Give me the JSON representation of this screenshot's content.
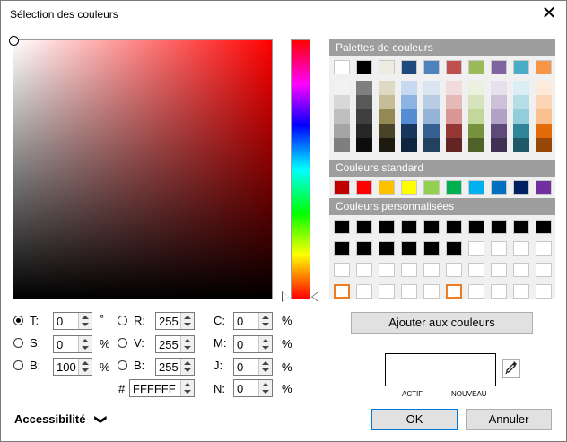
{
  "window": {
    "title": "Sélection des couleurs",
    "close_glyph": "✕"
  },
  "palettes": {
    "header": "Palettes de couleurs",
    "top_row": [
      "#ffffff",
      "#000000",
      "#eeece1",
      "#1f497d",
      "#4f81bd",
      "#c0504d",
      "#9bbb59",
      "#8064a2",
      "#4bacc6",
      "#f79646"
    ],
    "tint_columns": [
      [
        "#f2f2f2",
        "#d8d8d8",
        "#bfbfbf",
        "#a5a5a5",
        "#7f7f7f"
      ],
      [
        "#7f7f7f",
        "#595959",
        "#3f3f3f",
        "#262626",
        "#0c0c0c"
      ],
      [
        "#ddd9c3",
        "#c4bd97",
        "#938953",
        "#494429",
        "#1d1b10"
      ],
      [
        "#c6d9f0",
        "#8db3e2",
        "#548dd4",
        "#17365d",
        "#0f243e"
      ],
      [
        "#dbe5f1",
        "#b8cce4",
        "#95b3d7",
        "#366092",
        "#244061"
      ],
      [
        "#f2dcdb",
        "#e5b9b7",
        "#d99694",
        "#953734",
        "#632423"
      ],
      [
        "#ebf1dd",
        "#d7e3bc",
        "#c3d69b",
        "#76923c",
        "#4f6128"
      ],
      [
        "#e5e0ec",
        "#ccc1d9",
        "#b2a2c7",
        "#5f497a",
        "#3f3151"
      ],
      [
        "#dbeef3",
        "#b7dde8",
        "#92cddc",
        "#31859b",
        "#205867"
      ],
      [
        "#fdeada",
        "#fbd5b5",
        "#fac08f",
        "#e36c09",
        "#974806"
      ]
    ]
  },
  "standard": {
    "header": "Couleurs standard",
    "colors": [
      "#c00000",
      "#ff0000",
      "#ffc000",
      "#ffff00",
      "#92d050",
      "#00b050",
      "#00b0f0",
      "#0070c0",
      "#002060",
      "#7030a0"
    ]
  },
  "custom": {
    "header": "Couleurs personnalisées",
    "rows": [
      [
        "#000000",
        "#000000",
        "#000000",
        "#000000",
        "#000000",
        "#000000",
        "#000000",
        "#000000",
        "#000000",
        "#000000"
      ],
      [
        "#000000",
        "#000000",
        "#000000",
        "#000000",
        "#000000",
        "#000000",
        "#ffffff",
        "#ffffff",
        "#ffffff",
        "#ffffff"
      ],
      [
        "#ffffff",
        "#ffffff",
        "#ffffff",
        "#ffffff",
        "#ffffff",
        "#ffffff",
        "#ffffff",
        "#ffffff",
        "#ffffff",
        "#ffffff"
      ],
      [
        "#ffffff",
        "#ffffff",
        "#ffffff",
        "#ffffff",
        "#ffffff",
        "#ffffff",
        "#ffffff",
        "#ffffff",
        "#ffffff",
        "#ffffff"
      ]
    ],
    "selected": [
      [
        3,
        0
      ],
      [
        3,
        5
      ]
    ]
  },
  "hsb": {
    "t": {
      "label": "T:",
      "value": "0",
      "unit": "°"
    },
    "s": {
      "label": "S:",
      "value": "0",
      "unit": "%"
    },
    "b": {
      "label": "B:",
      "value": "100",
      "unit": "%"
    }
  },
  "rgb": {
    "r": {
      "label": "R:",
      "value": "255"
    },
    "v": {
      "label": "V:",
      "value": "255"
    },
    "b": {
      "label": "B:",
      "value": "255"
    },
    "hex_label": "#",
    "hex": "FFFFFF"
  },
  "cmyk": {
    "c": {
      "label": "C:",
      "value": "0",
      "unit": "%"
    },
    "m": {
      "label": "M:",
      "value": "0",
      "unit": "%"
    },
    "j": {
      "label": "J:",
      "value": "0",
      "unit": "%"
    },
    "n": {
      "label": "N:",
      "value": "0",
      "unit": "%"
    }
  },
  "add_button": "Ajouter aux couleurs",
  "preview": {
    "actif_label": "ACTIF",
    "nouveau_label": "NOUVEAU",
    "actif_color": "#ffffff",
    "nouveau_color": "#ffffff"
  },
  "accessibility": {
    "label": "Accessibilité",
    "chevron": "❯"
  },
  "buttons": {
    "ok": "OK",
    "cancel": "Annuler"
  },
  "colors": {
    "accent": "#0078d7",
    "header_bg": "#9e9e9e",
    "selected_swatch": "#f07c21"
  }
}
